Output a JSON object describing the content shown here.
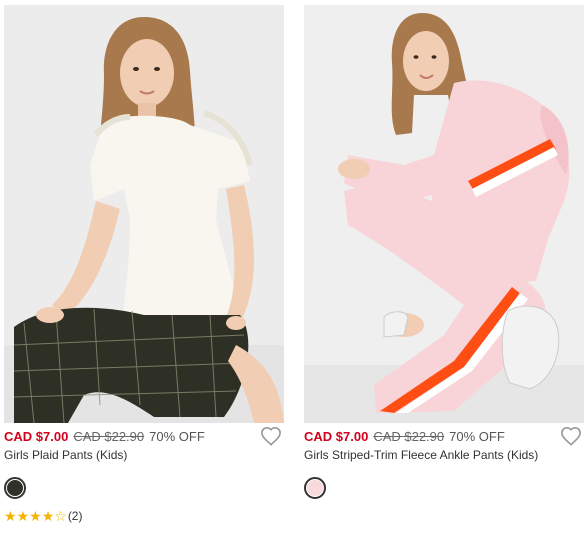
{
  "products": [
    {
      "sale_price": "CAD $7.00",
      "original_price": "CAD $22.90",
      "discount": "70% OFF",
      "name": "Girls Plaid Pants (Kids)",
      "swatch_color": "#2f3128",
      "rating": 4,
      "rating_max": 5,
      "review_count": "(2)",
      "image_alt": "Girl in white ruffled top and dark plaid pants"
    },
    {
      "sale_price": "CAD $7.00",
      "original_price": "CAD $22.90",
      "discount": "70% OFF",
      "name": "Girls Striped-Trim Fleece Ankle Pants (Kids)",
      "swatch_color": "#f8d9dc",
      "image_alt": "Girl in pink hoodie and pink fleece pants with orange stripe"
    }
  ],
  "colors": {
    "sale": "#d0021b",
    "star": "#f5b301",
    "heart": "#999999"
  },
  "icons": {
    "wishlist": "heart-outline-icon",
    "star_full": "star-filled-icon",
    "star_empty": "star-outline-icon"
  }
}
